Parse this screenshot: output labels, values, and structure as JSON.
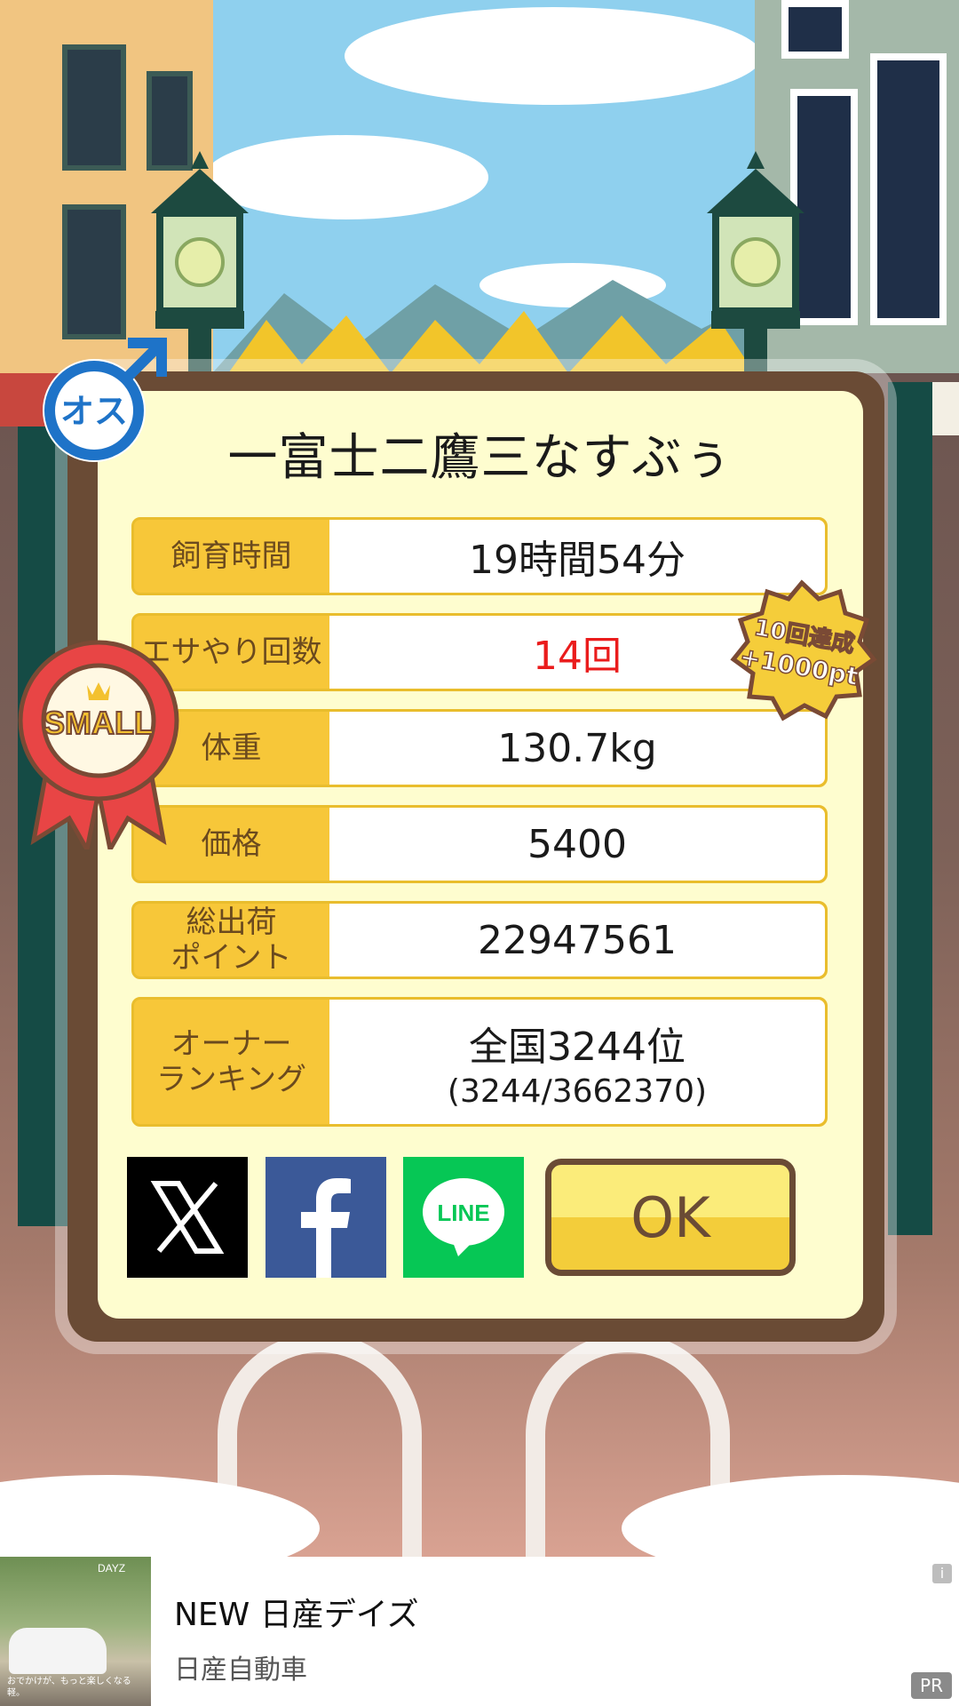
{
  "dialog": {
    "title": "一富士二鷹三なすぶぅ",
    "rows": [
      {
        "label": "飼育時間",
        "value": "19時間54分",
        "sub": ""
      },
      {
        "label": "エサやり回数",
        "value": "14回",
        "sub": ""
      },
      {
        "label": "体重",
        "value": "130.7kg",
        "sub": ""
      },
      {
        "label": "価格",
        "value": "5400",
        "sub": ""
      },
      {
        "label": "総出荷\nポイント",
        "value": "22947561",
        "sub": ""
      },
      {
        "label": "オーナー\nランキング",
        "value": "全国3244位",
        "sub": "(3244/3662370)"
      }
    ],
    "ok_label": "OK"
  },
  "badges": {
    "gender": "オス",
    "medal": "SMALL",
    "achievement_line1": "10回達成",
    "achievement_line2": "+1000pt"
  },
  "share": {
    "x_icon": "x-logo-icon",
    "facebook_icon": "facebook-logo-icon",
    "line_icon": "line-logo-icon",
    "line_text": "LINE"
  },
  "ad": {
    "title": "NEW 日産デイズ",
    "advertiser": "日産自動車",
    "info": "i",
    "pr": "PR",
    "thumb_brand": "DAYZ",
    "thumb_caption": "おでかけが、もっと楽しくなる軽。"
  },
  "colors": {
    "dialog_border": "#6a4b35",
    "dialog_bg": "#fefdcf",
    "label_bg": "#f7c739",
    "highlight_red": "#ea1c1c",
    "facebook_blue": "#3b5998",
    "line_green": "#06c755"
  }
}
